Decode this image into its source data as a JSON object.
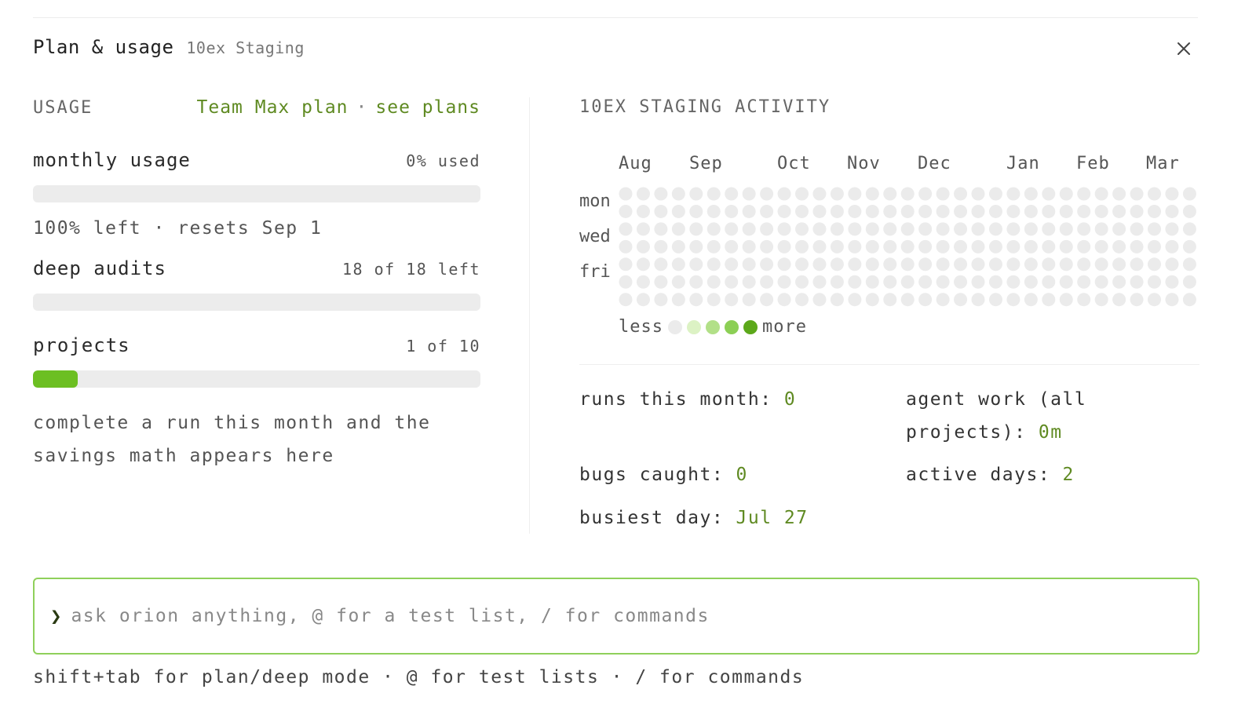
{
  "header": {
    "title": "Plan & usage",
    "subtitle": "10ex Staging",
    "close_icon": "close-icon"
  },
  "usage": {
    "label": "USAGE",
    "plan_name": "Team Max plan",
    "separator": "·",
    "see_plans": "see plans",
    "monthly": {
      "name": "monthly usage",
      "value": "0% used",
      "fraction": 0.0,
      "note": "100% left · resets Sep 1"
    },
    "audits": {
      "name": "deep audits",
      "value": "18 of 18 left",
      "fraction": 0.0
    },
    "projects": {
      "name": "projects",
      "value": "1 of 10",
      "fraction": 0.1
    },
    "savings_note": "complete a run this month and the savings math appears here"
  },
  "activity": {
    "title": "10EX STAGING ACTIVITY",
    "months": [
      "Aug",
      "Sep",
      "Oct",
      "Nov",
      "Dec",
      "Jan",
      "Feb",
      "Mar"
    ],
    "day_labels": [
      "mon",
      "wed",
      "fri"
    ],
    "columns": 33,
    "rows": 7,
    "legend_less": "less",
    "legend_more": "more",
    "legend_colors": [
      "#ebebeb",
      "#dcf2c4",
      "#b2e088",
      "#8ccf55",
      "#5ca81a"
    ],
    "empty_color": "#ebebeb"
  },
  "stats": {
    "runs_label": "runs this month:",
    "runs_value": "0",
    "agent_label": "agent work (all projects):",
    "agent_value": "0m",
    "bugs_label": "bugs caught:",
    "bugs_value": "0",
    "active_label": "active days:",
    "active_value": "2",
    "busiest_label": "busiest day:",
    "busiest_value": "Jul 27"
  },
  "prompt": {
    "chevron": "❯",
    "placeholder": "ask orion anything, @ for a test list, / for commands",
    "value": ""
  },
  "hint": "shift+tab for plan/deep mode · @ for test lists · / for commands",
  "colors": {
    "accent": "#5f8a22",
    "bar_fill": "#6cbf22",
    "input_border": "#8fd05a"
  }
}
